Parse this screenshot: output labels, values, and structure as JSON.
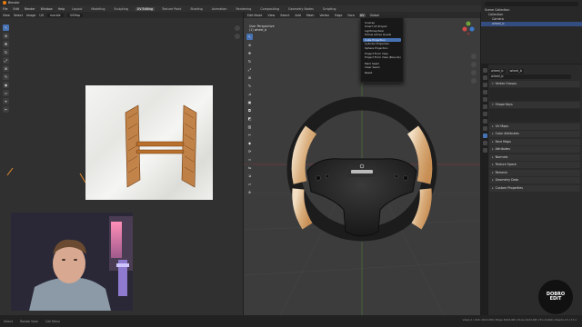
{
  "app": {
    "window_title": "Blender",
    "window_controls": [
      "–",
      "□",
      "×"
    ]
  },
  "menubar": {
    "menus": [
      "File",
      "Edit",
      "Render",
      "Window",
      "Help"
    ],
    "workspaces": [
      "Layout",
      "Modeling",
      "Sculpting",
      "UV Editing",
      "Texture Paint",
      "Shading",
      "Animation",
      "Rendering",
      "Compositing",
      "Geometry Nodes",
      "Scripting"
    ],
    "active_workspace": "UV Editing",
    "scene": "Scene",
    "view_layer": "ViewLayer"
  },
  "uv_editor": {
    "header": [
      "View",
      "Select",
      "Image",
      "UV"
    ],
    "image_name": "marble",
    "uv_map": "UVMap"
  },
  "viewport": {
    "mode": "Edit Mode",
    "menus": [
      "View",
      "Select",
      "Add",
      "Mesh",
      "Vertex",
      "Edge",
      "Face",
      "UV"
    ],
    "open_menu": "UV",
    "orientation": "Global",
    "overlay_line1": "User Perspective",
    "overlay_line2": "(1) wheel_b",
    "steering_logo": "DAF"
  },
  "uv_menu": {
    "items": [
      "Unwrap",
      "Smart UV Project",
      "Lightmap Pack",
      "Follow Active Quads",
      "",
      "Cube Projection",
      "Cylinder Projection",
      "Sphere Projection",
      "",
      "Project From View",
      "Project From View (Bounds)",
      "",
      "Mark Seam",
      "Clear Seam",
      "",
      "Reset"
    ],
    "highlighted": "Cube Projection"
  },
  "outliner": {
    "search_placeholder": "",
    "rows": [
      "Scene Collection",
      "Collection",
      "Camera",
      "wheel_b"
    ]
  },
  "properties": {
    "object": "wheel_b",
    "mesh": "wheel_b",
    "sections": [
      "Vertex Groups",
      "Shape Keys",
      "UV Maps",
      "Color Attributes",
      "Face Maps",
      "Attributes",
      "Normals",
      "Texture Space",
      "Remesh",
      "Geometry Data",
      "Custom Properties"
    ]
  },
  "statusbar": {
    "items": [
      "Select",
      "Rotate View",
      "Call Menu"
    ],
    "version": "wheel_b | Verts 18/12,480 | Edges 36/24,960 | Faces 16/12,480 | Tris 24,960 | Objects 1/3 | 3.5.1"
  },
  "badge": {
    "line1": "DOBRO",
    "line2": "EDIT"
  },
  "colors": {
    "accent": "#4772b3",
    "leather": "#2a2a2a",
    "wood": "#c38a4f"
  }
}
